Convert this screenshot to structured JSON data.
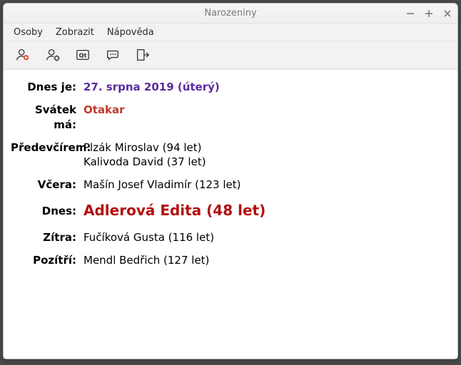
{
  "window": {
    "title": "Narozeniny"
  },
  "menu": {
    "items": [
      "Osoby",
      "Zobrazit",
      "Nápověda"
    ]
  },
  "toolbar": {
    "buttons": [
      {
        "name": "add-person-icon"
      },
      {
        "name": "person-settings-icon"
      },
      {
        "name": "qt-about-icon"
      },
      {
        "name": "speech-bubble-icon"
      },
      {
        "name": "exit-icon"
      }
    ]
  },
  "rows": {
    "today_is": {
      "label": "Dnes je:",
      "value": "27. srpna 2019 (úterý)"
    },
    "nameday": {
      "label": "Svátek má:",
      "value": "Otakar"
    },
    "day_before_yesterday": {
      "label": "Předevčírem:",
      "values": [
        "Plzák Miroslav (94 let)",
        "Kalivoda David (37 let)"
      ]
    },
    "yesterday": {
      "label": "Včera:",
      "value": "Mašín Josef Vladimír (123 let)"
    },
    "today": {
      "label": "Dnes:",
      "value": "Adlerová Edita (48 let)"
    },
    "tomorrow": {
      "label": "Zítra:",
      "value": "Fučíková Gusta (116 let)"
    },
    "day_after_tomorrow": {
      "label": "Pozítří:",
      "value": "Mendl Bedřich (127 let)"
    }
  }
}
